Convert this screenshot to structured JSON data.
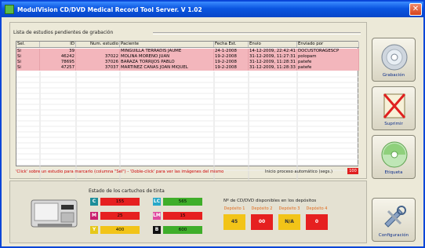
{
  "window": {
    "title": "ModulVision CD/DVD Medical Record Tool Server. V 1.02",
    "close_symbol": "✕"
  },
  "list": {
    "caption": "Lista de estudios pendientes de grabación",
    "columns": [
      "Sel.",
      "ID",
      "Num. estudio",
      "Paciente",
      "Fecha Est.",
      "Envío",
      "Enviado por"
    ],
    "rows": [
      [
        "Si",
        "39",
        "",
        "MINGUILLA TERRADIS JAUME",
        "24-1-2008",
        "14-12-2009, 22:42:41",
        "DOCUSTORAGESCP"
      ],
      [
        "Si",
        "46242",
        "37022",
        "MOLINA MORENO JUAN",
        "19-2-2008",
        "31-12-2009, 11:27:31",
        "polopam"
      ],
      [
        "Si",
        "78695",
        "37026",
        "BARAZA TORRIJOS PABLO",
        "19-2-2008",
        "31-12-2009, 11:28:31",
        "patefe"
      ],
      [
        "Si",
        "47257",
        "37037",
        "MARTINEZ CAÑAS JOAN MIQUEL",
        "19-2-2008",
        "31-12-2009, 11:28:33",
        "patefe"
      ]
    ]
  },
  "hint": "'Click' sobre un estudio para marcarlo (columna \"Sel\") - 'Doble-click' para ver las imágenes del mismo",
  "auto_process": {
    "label": "Inicio proceso automático (segs.)",
    "value": "100"
  },
  "ink": {
    "title": "Estado de los cartuchos de tinta",
    "cartridges": [
      {
        "code": "C",
        "value": "155",
        "code_color": "#1d8e9a",
        "bar_color": "#e62020"
      },
      {
        "code": "LC",
        "value": "565",
        "code_color": "#28a8c8",
        "bar_color": "#3fae2a"
      },
      {
        "code": "M",
        "value": "25",
        "code_color": "#c81e6e",
        "bar_color": "#e62020"
      },
      {
        "code": "LM",
        "value": "15",
        "code_color": "#e04aa0",
        "bar_color": "#e62020"
      },
      {
        "code": "Y",
        "value": "400",
        "code_color": "#e6c81a",
        "bar_color": "#f2c418"
      },
      {
        "code": "B",
        "value": "600",
        "code_color": "#111111",
        "bar_color": "#3fae2a"
      }
    ]
  },
  "discs": {
    "title": "Nº de CD/DVD disponibles en los depósitos",
    "deposits": [
      {
        "label": "Depósito 1",
        "value": "45",
        "color": "#f2c418"
      },
      {
        "label": "Depósito 2",
        "value": "00",
        "color": "#e62020"
      },
      {
        "label": "Depósito 3",
        "value": "N/A",
        "color": "#f2c418"
      },
      {
        "label": "Depósito 4",
        "value": "0",
        "color": "#e62020"
      }
    ]
  },
  "sidebar": {
    "grabacion": "Grabación",
    "suprimir": "Suprimir",
    "etiqueta": "Etiqueta",
    "configuracion": "Configuración"
  }
}
